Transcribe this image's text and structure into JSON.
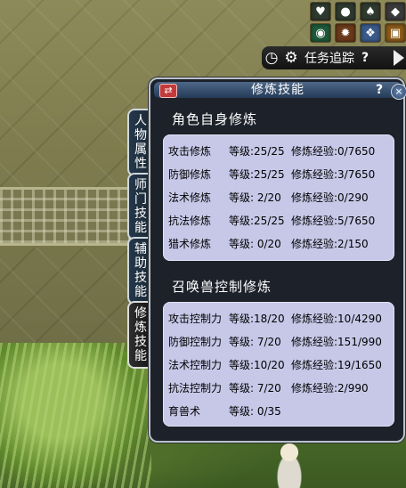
{
  "hud": {
    "task_label": "任务追踪",
    "help": "?",
    "icons": [
      "heart-icon",
      "pearl-icon",
      "bottle-icon",
      "silver-bag-icon",
      "green-gem-icon",
      "fire-icon",
      "scroll-icon",
      "treasure-chest-icon"
    ]
  },
  "tabs": [
    {
      "label": "人物属性"
    },
    {
      "label": "师门技能"
    },
    {
      "label": "辅助技能"
    },
    {
      "label": "修炼技能"
    }
  ],
  "window": {
    "title": "修炼技能",
    "help": "?",
    "close": "×",
    "swap": "⇄"
  },
  "self_section": {
    "title": "角色自身修炼",
    "rows": [
      {
        "name": "攻击修炼",
        "level": "等级:25/25",
        "exp": "修炼经验:0/7650"
      },
      {
        "name": "防御修炼",
        "level": "等级:25/25",
        "exp": "修炼经验:3/7650"
      },
      {
        "name": "法术修炼",
        "level": "等级: 2/20",
        "exp": "修炼经验:0/290"
      },
      {
        "name": "抗法修炼",
        "level": "等级:25/25",
        "exp": "修炼经验:5/7650"
      },
      {
        "name": "猎术修炼",
        "level": "等级: 0/20",
        "exp": "修炼经验:2/150"
      }
    ]
  },
  "pet_section": {
    "title": "召唤兽控制修炼",
    "rows": [
      {
        "name": "攻击控制力",
        "level": "等级:18/20",
        "exp": "修炼经验:10/4290"
      },
      {
        "name": "防御控制力",
        "level": "等级: 7/20",
        "exp": "修炼经验:151/990"
      },
      {
        "name": "法术控制力",
        "level": "等级:10/20",
        "exp": "修炼经验:19/1650"
      },
      {
        "name": "抗法控制力",
        "level": "等级: 7/20",
        "exp": "修炼经验:2/990"
      },
      {
        "name": "育兽术",
        "level": "等级: 0/35",
        "exp": ""
      }
    ]
  }
}
